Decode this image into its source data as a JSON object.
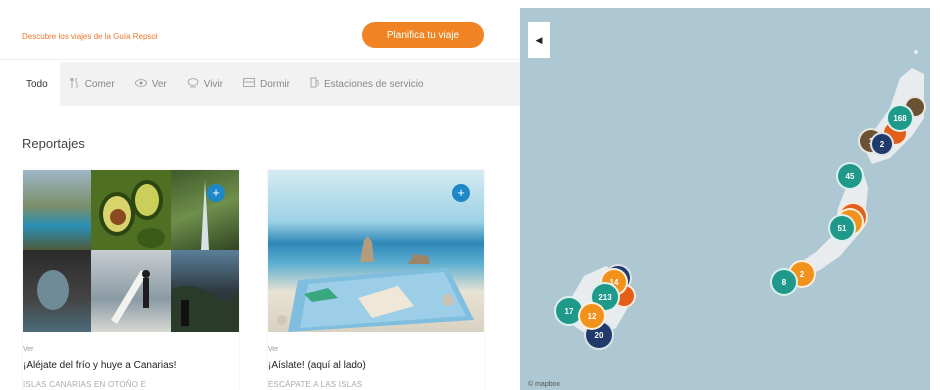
{
  "header": {
    "tagline": "Descubre los viajes de la Guía Repsol",
    "plan_button": "Planifica tu viaje"
  },
  "tabs": [
    {
      "label": "Todo",
      "icon": "none"
    },
    {
      "label": "Comer",
      "icon": "cutlery-icon"
    },
    {
      "label": "Ver",
      "icon": "eye-icon"
    },
    {
      "label": "Vivir",
      "icon": "bubble-icon"
    },
    {
      "label": "Dormir",
      "icon": "bed-icon"
    },
    {
      "label": "Estaciones de servicio",
      "icon": "fuel-icon"
    }
  ],
  "section_title": "Reportajes",
  "cards": [
    {
      "category": "Ver",
      "title": "¡Aléjate del frío y huye a Canarias!",
      "subtitle": "ISLAS CANARIAS EN OTOÑO E"
    },
    {
      "category": "Ver",
      "title": "¡Aíslate! (aquí al lado)",
      "subtitle": "ESCÁPATE A LAS ISLAS"
    }
  ],
  "map": {
    "toggle": "◀",
    "credit": "© mapbox",
    "clusters": [
      {
        "label": "168",
        "color": "teal"
      },
      {
        "label": "2",
        "color": "navy"
      },
      {
        "label": "1",
        "color": "brown"
      },
      {
        "label": "45",
        "color": "teal"
      },
      {
        "label": "51",
        "color": "teal"
      },
      {
        "label": "2",
        "color": "orange"
      },
      {
        "label": "8",
        "color": "teal"
      },
      {
        "label": "14",
        "color": "orange"
      },
      {
        "label": "213",
        "color": "teal"
      },
      {
        "label": "17",
        "color": "teal"
      },
      {
        "label": "12",
        "color": "orange"
      },
      {
        "label": "20",
        "color": "navy"
      }
    ]
  },
  "colors": {
    "accent": "#f08323",
    "teal": "#1f9a8a",
    "navy": "#1f3a6b",
    "sea": "#adc8d3"
  }
}
